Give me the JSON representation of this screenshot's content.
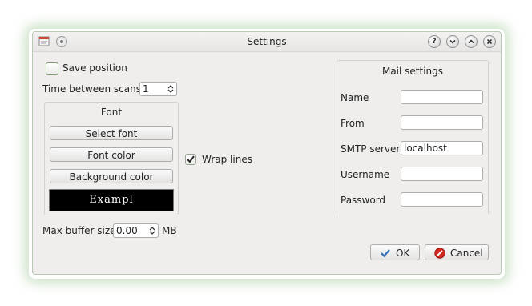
{
  "window": {
    "title": "Settings"
  },
  "left": {
    "save_position_label": "Save position",
    "save_position_checked": false,
    "time_between_scans_label": "Time between scans",
    "time_between_scans_value": "1",
    "font_group_title": "Font",
    "select_font_label": "Select font",
    "font_color_label": "Font color",
    "background_color_label": "Background color",
    "example_text": "Exampl",
    "max_buffer_label": "Max buffer size",
    "max_buffer_value": "0.00",
    "max_buffer_unit": "MB"
  },
  "wrap_lines": {
    "label": "Wrap lines",
    "checked": true
  },
  "mail": {
    "title": "Mail settings",
    "name_label": "Name",
    "name_value": "",
    "from_label": "From",
    "from_value": "",
    "smtp_label": "SMTP server",
    "smtp_value": "localhost",
    "username_label": "Username",
    "username_value": "",
    "password_label": "Password",
    "password_value": ""
  },
  "buttons": {
    "ok_label": "OK",
    "cancel_label": "Cancel"
  },
  "colors": {
    "example_bg": "#000000",
    "example_fg": "#ffffff",
    "check_green": "#3c6b2b",
    "cancel_red": "#d1271f",
    "ok_blue": "#2f6fb8"
  },
  "icons": {
    "app": "app-icon",
    "menu": "window-menu-icon",
    "help": "help-icon",
    "minimize": "minimize-icon",
    "maximize": "maximize-icon",
    "close": "close-icon"
  }
}
